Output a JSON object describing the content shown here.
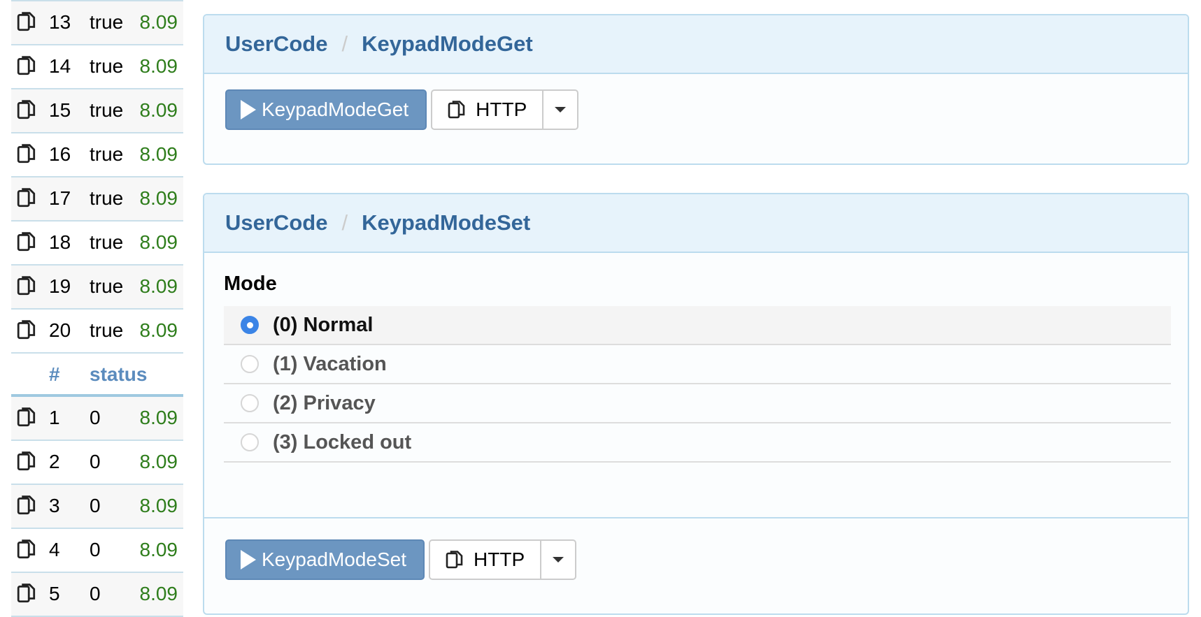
{
  "left_table": {
    "top_rows": [
      {
        "num": "13",
        "status": "true",
        "version": "8.09"
      },
      {
        "num": "14",
        "status": "true",
        "version": "8.09"
      },
      {
        "num": "15",
        "status": "true",
        "version": "8.09"
      },
      {
        "num": "16",
        "status": "true",
        "version": "8.09"
      },
      {
        "num": "17",
        "status": "true",
        "version": "8.09"
      },
      {
        "num": "18",
        "status": "true",
        "version": "8.09"
      },
      {
        "num": "19",
        "status": "true",
        "version": "8.09"
      },
      {
        "num": "20",
        "status": "true",
        "version": "8.09"
      }
    ],
    "header": {
      "num": "#",
      "status": "status"
    },
    "bottom_rows": [
      {
        "num": "1",
        "status": "0",
        "version": "8.09"
      },
      {
        "num": "2",
        "status": "0",
        "version": "8.09"
      },
      {
        "num": "3",
        "status": "0",
        "version": "8.09"
      },
      {
        "num": "4",
        "status": "0",
        "version": "8.09"
      },
      {
        "num": "5",
        "status": "0",
        "version": "8.09"
      }
    ]
  },
  "panel_get": {
    "breadcrumb_class": "UserCode",
    "breadcrumb_sep": "/",
    "breadcrumb_method": "KeypadModeGet",
    "run_label": "KeypadModeGet",
    "http_label": "HTTP"
  },
  "panel_set": {
    "breadcrumb_class": "UserCode",
    "breadcrumb_sep": "/",
    "breadcrumb_method": "KeypadModeSet",
    "mode_label": "Mode",
    "options": [
      {
        "label": "(0) Normal",
        "selected": true
      },
      {
        "label": "(1) Vacation",
        "selected": false
      },
      {
        "label": "(2) Privacy",
        "selected": false
      },
      {
        "label": "(3) Locked out",
        "selected": false
      }
    ],
    "run_label": "KeypadModeSet",
    "http_label": "HTTP"
  },
  "colors": {
    "accent": "#336699",
    "run_button": "#6c96c1",
    "version_green": "#2e7d1b",
    "radio_selected": "#3b84e6"
  }
}
